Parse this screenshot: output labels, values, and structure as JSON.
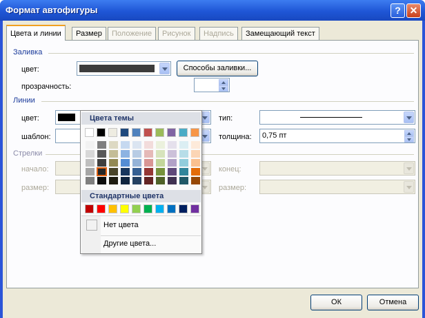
{
  "window": {
    "title": "Формат автофигуры",
    "help_glyph": "?",
    "close_glyph": "✕"
  },
  "tabs": [
    {
      "label": "Цвета и линии"
    },
    {
      "label": "Размер"
    },
    {
      "label": "Положение"
    },
    {
      "label": "Рисунок"
    },
    {
      "label": "Надпись"
    },
    {
      "label": "Замещающий текст"
    }
  ],
  "fill": {
    "section": "Заливка",
    "color_label": "цвет:",
    "color_value": "#3c3c3c",
    "methods_button": "Способы заливки...",
    "transparency_label": "прозрачность:"
  },
  "lines": {
    "section": "Линии",
    "color_label": "цвет:",
    "pattern_label": "шаблон:",
    "type_label": "тип:",
    "weight_label": "толщина:",
    "weight_value": "0,75 пт"
  },
  "arrows": {
    "section": "Стрелки",
    "start_label": "начало:",
    "start_size_label": "размер:",
    "end_label": "конец:",
    "end_size_label": "размер:"
  },
  "palette": {
    "theme_header": "Цвета темы",
    "theme_base": [
      "#ffffff",
      "#000000",
      "#eeece1",
      "#1f497d",
      "#4f81bd",
      "#c0504d",
      "#9bbb59",
      "#8064a2",
      "#4bacc6",
      "#f79646"
    ],
    "theme_tints": [
      [
        "#f2f2f2",
        "#7f7f7f",
        "#ddd9c3",
        "#c6d9f0",
        "#dbe5f1",
        "#f2dcdb",
        "#ebf1dd",
        "#e5e0ec",
        "#dbeef3",
        "#fdeada"
      ],
      [
        "#d8d8d8",
        "#595959",
        "#c4bd97",
        "#8db3e2",
        "#b8cce4",
        "#e5b9b7",
        "#d7e3bc",
        "#ccc1d9",
        "#b7dde8",
        "#fbd5b5"
      ],
      [
        "#bfbfbf",
        "#3f3f3f",
        "#938953",
        "#548dd4",
        "#95b3d7",
        "#d99694",
        "#c3d69b",
        "#b2a2c7",
        "#92cddc",
        "#fac08f"
      ],
      [
        "#a5a5a5",
        "#262626",
        "#494429",
        "#17365d",
        "#366092",
        "#953734",
        "#76923c",
        "#5f497a",
        "#31859b",
        "#e36c09"
      ],
      [
        "#7f7f7f",
        "#0c0c0c",
        "#1d1b10",
        "#0f243e",
        "#244061",
        "#632423",
        "#4f6128",
        "#3f3151",
        "#205867",
        "#974806"
      ]
    ],
    "selected": "#262626",
    "standard_header": "Стандартные цвета",
    "standard": [
      "#c00000",
      "#ff0000",
      "#ffc000",
      "#ffff00",
      "#92d050",
      "#00b050",
      "#00b0f0",
      "#0070c0",
      "#002060",
      "#7030a0"
    ],
    "no_color": "Нет цвета",
    "more_colors": "Другие цвета..."
  },
  "buttons": {
    "ok": "ОК",
    "cancel": "Отмена"
  }
}
